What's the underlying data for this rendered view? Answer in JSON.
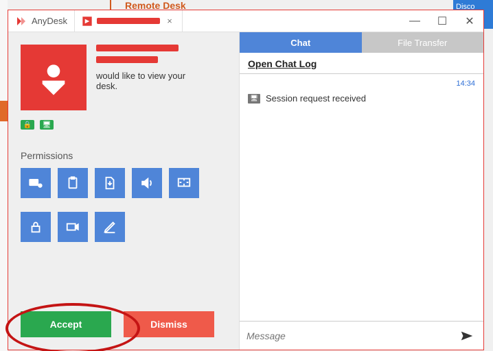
{
  "bg": {
    "remote_desk": "Remote Desk",
    "disco": "Disco"
  },
  "titlebar": {
    "home_label": "AnyDesk",
    "tab_redacted_name": "[redacted]",
    "close_glyph": "×",
    "min_glyph": "—",
    "max_glyph": "☐",
    "x_glyph": "✕"
  },
  "request": {
    "name_redacted": "[redacted]",
    "id_redacted": "[redacted]",
    "line1": "would like to view your",
    "line2": "desk."
  },
  "permissions": {
    "label": "Permissions",
    "items": [
      "keyboard-mouse",
      "clipboard",
      "file",
      "sound",
      "screen",
      "lock",
      "record",
      "draw"
    ]
  },
  "actions": {
    "accept": "Accept",
    "dismiss": "Dismiss"
  },
  "right": {
    "tab_chat": "Chat",
    "tab_ft": "File Transfer",
    "open_log": "Open Chat Log",
    "time": "14:34",
    "sys_msg": "Session request received",
    "msg_placeholder": "Message"
  }
}
